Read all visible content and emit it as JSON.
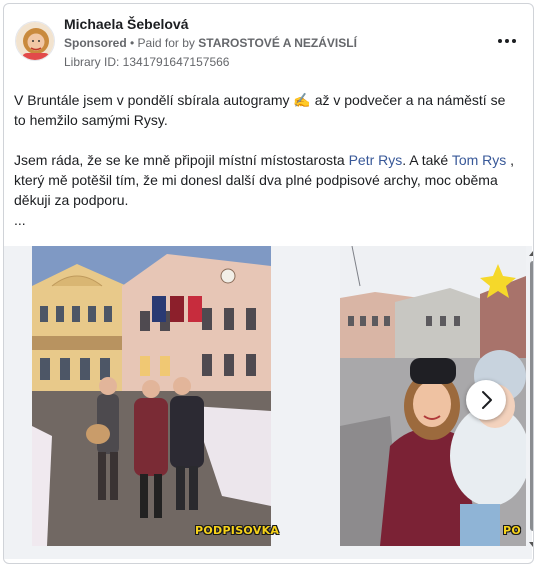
{
  "post": {
    "author": "Michaela Šebelová",
    "sponsored": "Sponsored",
    "paid_prefix": " • Paid for by ",
    "payer": "STAROSTOVÉ A NEZÁVISLÍ",
    "library_id": "Library ID: 1341791647157566",
    "more_icon": "more-horizontal-icon",
    "text": {
      "p1_a": "V Bruntále jsem v pondělí sbírala autogramy ",
      "emoji": "✍️",
      "p1_b": " až v podvečer a na náměstí se to hemžilo samými Rysy.",
      "p2_a": "Jsem ráda, že se ke mně připojil místní místostarosta ",
      "link1": "Petr Rys",
      "p2_b": ". A také ",
      "link2": "Tom Rys",
      "p2_c": " , který mě potěšil tím, že mi donesl další dva plné podpisové archy, moc oběma děkuji za podporu.",
      "ellipsis": "..."
    }
  },
  "media": {
    "badge1": "PODPISOVKA",
    "badge2": "PO",
    "next_icon": "chevron-right-icon"
  },
  "colors": {
    "link": "#385898",
    "badge": "#f6d21a",
    "meta": "#65676b"
  }
}
